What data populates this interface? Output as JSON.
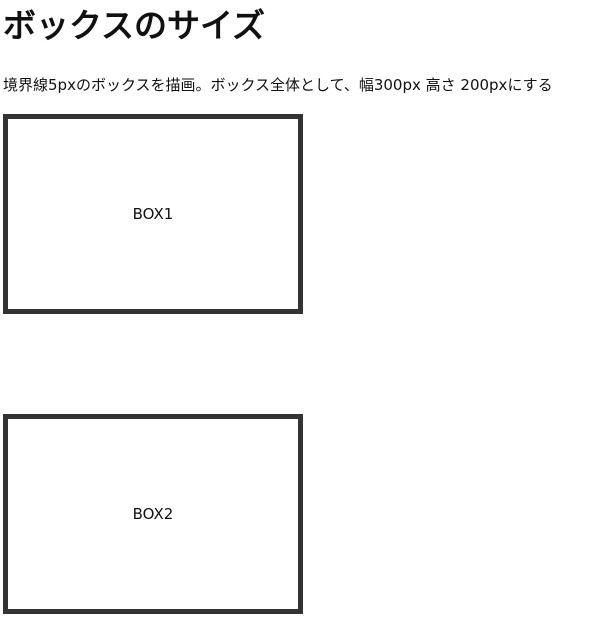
{
  "page": {
    "title": "ボックスのサイズ",
    "description": "境界線5pxのボックスを描画。ボックス全体として、幅300px 高さ 200pxにする"
  },
  "boxes": [
    {
      "label": "BOX1"
    },
    {
      "label": "BOX2"
    }
  ],
  "colors": {
    "border": "#333333",
    "text": "#111111",
    "background": "#ffffff"
  }
}
